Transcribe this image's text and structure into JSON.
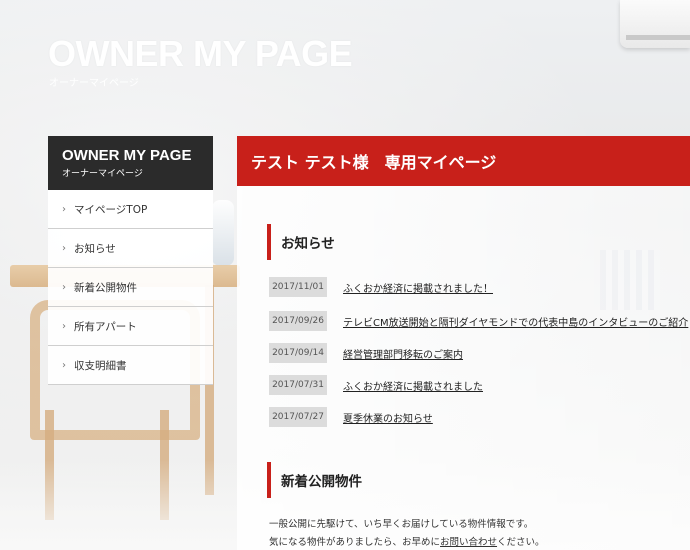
{
  "header": {
    "title": "OWNER MY PAGE",
    "subtitle": "オーナーマイページ"
  },
  "sidebar": {
    "head_title": "OWNER MY PAGE",
    "head_subtitle": "オーナーマイページ",
    "items": [
      {
        "label": "マイページTOP"
      },
      {
        "label": "お知らせ"
      },
      {
        "label": "新着公開物件"
      },
      {
        "label": "所有アパート"
      },
      {
        "label": "収支明細書"
      }
    ]
  },
  "main": {
    "banner": "テスト テスト様　専用マイページ",
    "news_heading": "お知らせ",
    "news": [
      {
        "date": "2017/11/01",
        "title": "ふくおか経済に掲載されました！"
      },
      {
        "date": "2017/09/26",
        "title": "テレビCM放送開始と隔刊ダイヤモンドでの代表中島のインタビューのご紹介"
      },
      {
        "date": "2017/09/14",
        "title": "経営管理部門移転のご案内"
      },
      {
        "date": "2017/07/31",
        "title": "ふくおか経済に掲載されました"
      },
      {
        "date": "2017/07/27",
        "title": "夏季休業のお知らせ"
      }
    ],
    "new_heading": "新着公開物件",
    "intro_line1": "一般公開に先駆けて、いち早くお届けしている物件情報です。",
    "intro_line2_pre": "気になる物件がありましたら、お早めに",
    "intro_line2_link": "お問い合わせ",
    "intro_line2_post": "ください。"
  },
  "colors": {
    "accent": "#c8201a",
    "sidebar_head": "#2b2b2b",
    "date_bg": "#dcdcdc"
  }
}
